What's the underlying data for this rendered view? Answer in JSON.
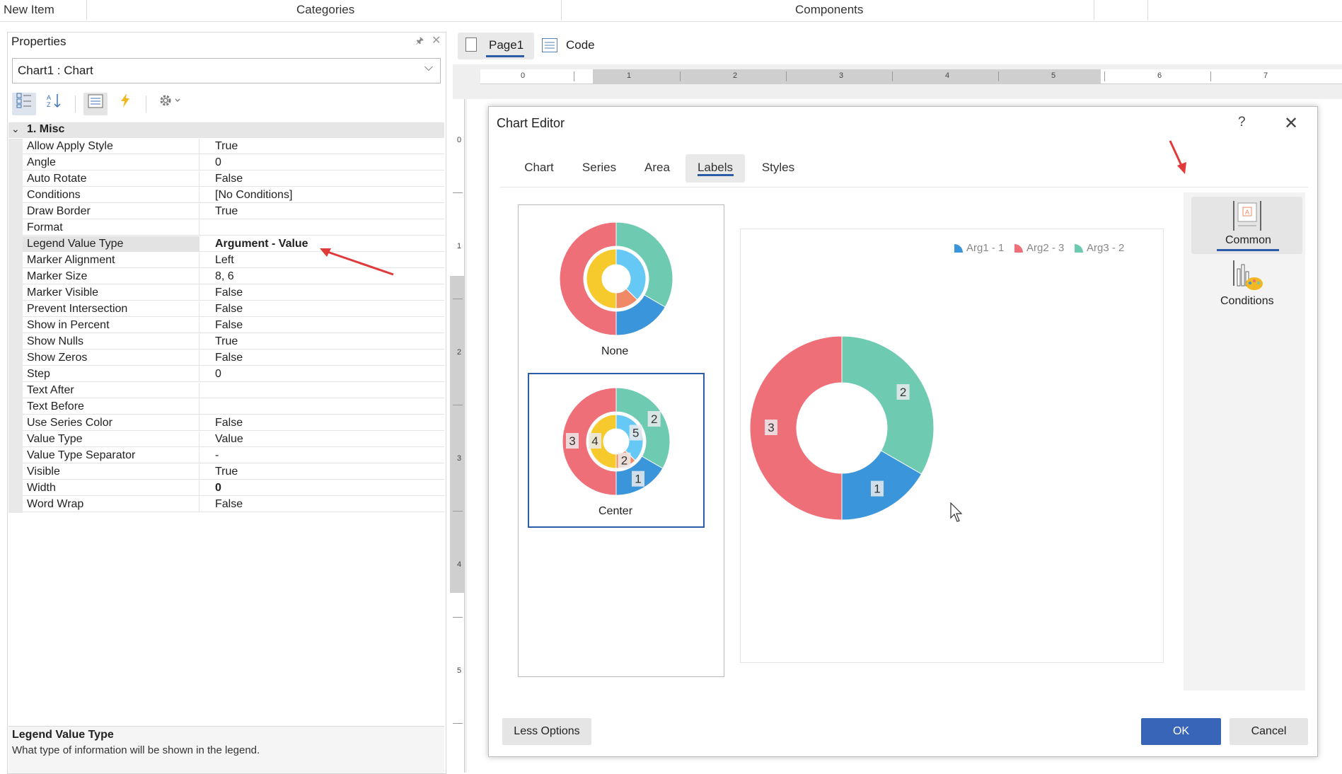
{
  "topbar": {
    "new_item": "New Item",
    "categories": "Categories",
    "components": "Components"
  },
  "properties": {
    "title": "Properties",
    "object_selector": "Chart1 : Chart",
    "group": "1. Misc",
    "rows": [
      {
        "name": "Allow Apply Style",
        "value": "True"
      },
      {
        "name": "Angle",
        "value": "0"
      },
      {
        "name": "Auto Rotate",
        "value": "False"
      },
      {
        "name": "Conditions",
        "value": "[No Conditions]"
      },
      {
        "name": "Draw Border",
        "value": "True"
      },
      {
        "name": "Format",
        "value": ""
      },
      {
        "name": "Legend Value Type",
        "value": "Argument - Value"
      },
      {
        "name": "Marker Alignment",
        "value": "Left"
      },
      {
        "name": "Marker Size",
        "value": "8, 6"
      },
      {
        "name": "Marker Visible",
        "value": "False"
      },
      {
        "name": "Prevent Intersection",
        "value": "False"
      },
      {
        "name": "Show in Percent",
        "value": "False"
      },
      {
        "name": "Show Nulls",
        "value": "True"
      },
      {
        "name": "Show Zeros",
        "value": "False"
      },
      {
        "name": "Step",
        "value": "0"
      },
      {
        "name": "Text After",
        "value": ""
      },
      {
        "name": "Text Before",
        "value": ""
      },
      {
        "name": "Use Series Color",
        "value": "False"
      },
      {
        "name": "Value Type",
        "value": "Value"
      },
      {
        "name": "Value Type Separator",
        "value": "-"
      },
      {
        "name": "Visible",
        "value": "True"
      },
      {
        "name": "Width",
        "value": "0"
      },
      {
        "name": "Word Wrap",
        "value": "False"
      }
    ],
    "description_title": "Legend Value Type",
    "description_text": "What type of information will be shown in the legend."
  },
  "designer": {
    "page_tab": "Page1",
    "code_tab": "Code",
    "ruler_h": [
      "0",
      "1",
      "2",
      "3",
      "4",
      "5",
      "6",
      "7"
    ],
    "ruler_v": [
      "0",
      "1",
      "2",
      "3",
      "4",
      "5"
    ]
  },
  "chart_editor": {
    "title": "Chart Editor",
    "help": "?",
    "tabs": [
      "Chart",
      "Series",
      "Area",
      "Labels",
      "Styles"
    ],
    "active_tab": "Labels",
    "label_options": [
      "None",
      "Center"
    ],
    "selected_option": "Center",
    "right_panel": [
      "Common",
      "Conditions"
    ],
    "buttons": {
      "less_options": "Less Options",
      "ok": "OK",
      "cancel": "Cancel"
    },
    "colors": {
      "accent": "#2c5ba8",
      "ok_button": "#3865b8"
    }
  },
  "chart_data": {
    "type": "pie",
    "variant": "doughnut",
    "legend_position": "top-right",
    "legend": [
      "Arg1 - 1",
      "Arg2 - 3",
      "Arg3 - 2"
    ],
    "categories": [
      "Arg1",
      "Arg2",
      "Arg3"
    ],
    "values": [
      1,
      3,
      2
    ],
    "labels": [
      "1",
      "3",
      "2"
    ],
    "colors": [
      "#3a95da",
      "#ee6f78",
      "#6ecbb2"
    ],
    "thumbnail_center_labels": {
      "outer": [
        "2",
        "1",
        "3"
      ],
      "inner": [
        "5",
        "2",
        "4"
      ]
    },
    "thumbnail_inner_colors": [
      "#66c8f5",
      "#f08a66",
      "#f6ca2c"
    ]
  }
}
